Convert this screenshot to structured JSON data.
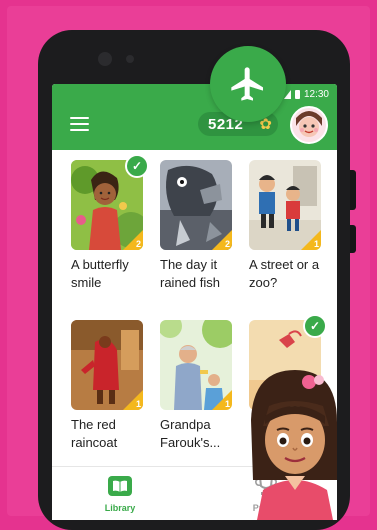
{
  "status_bar": {
    "time": "12:30"
  },
  "header": {
    "coins": "5212",
    "menu_icon": "hamburger-menu-icon",
    "coin_icon": "star-coin-icon"
  },
  "books": [
    {
      "title": "A butterfly smile",
      "level": "2",
      "completed": true,
      "cover_color": "#8fbf45"
    },
    {
      "title": "The day it rained fish",
      "level": "2",
      "completed": false,
      "cover_color": "#7b8390"
    },
    {
      "title": "A street or a zoo?",
      "level": "1",
      "completed": false,
      "cover_color": "#f2efe4"
    },
    {
      "title": "The red raincoat",
      "level": "1",
      "completed": false,
      "cover_color": "#a46b39"
    },
    {
      "title": "Grandpa Farouk's...",
      "level": "1",
      "completed": false,
      "cover_color": "#d9ecc4"
    },
    {
      "title": "",
      "level": "",
      "completed": true,
      "cover_color": "#f1d7a7"
    }
  ],
  "nav": {
    "library_label": "Library",
    "prizes_label": "Prizes",
    "active_color": "#3aaa4a",
    "inactive_color": "#9e9e9e"
  },
  "colors": {
    "accent": "#3aaa4a",
    "background": "#e5338f",
    "level_badge": "#f4b81d"
  }
}
